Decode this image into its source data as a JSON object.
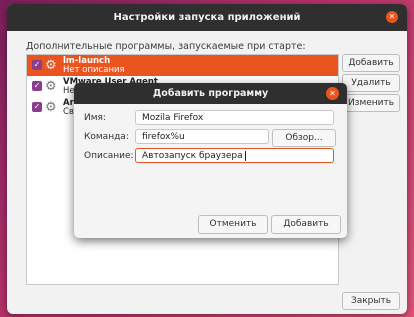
{
  "window": {
    "title": "Настройки запуска приложений",
    "list_label": "Дополнительные программы, запускаемые при старте:",
    "items": [
      {
        "name": "lm-launch",
        "description": "Нет описания",
        "checked": true,
        "selected": true
      },
      {
        "name": "VMware User Agent",
        "description": "Нет",
        "checked": true,
        "selected": false
      },
      {
        "name": "Are",
        "description": "Свя",
        "checked": true,
        "selected": false
      }
    ],
    "buttons": {
      "add": "Добавить",
      "remove": "Удалить",
      "edit": "Изменить",
      "close": "Закрыть"
    }
  },
  "dialog": {
    "title": "Добавить программу",
    "name_label": "Имя:",
    "name_value": "Mozila Firefox",
    "command_label": "Команда:",
    "command_value": "firefox%u",
    "browse": "Обзор...",
    "description_label": "Описание:",
    "description_value": "Автозапуск браузера",
    "cancel": "Отменить",
    "add": "Добавить"
  },
  "colors": {
    "accent": "#e9541f",
    "checkbox": "#8a3d8c",
    "titlebar": "#2f2f2f"
  }
}
